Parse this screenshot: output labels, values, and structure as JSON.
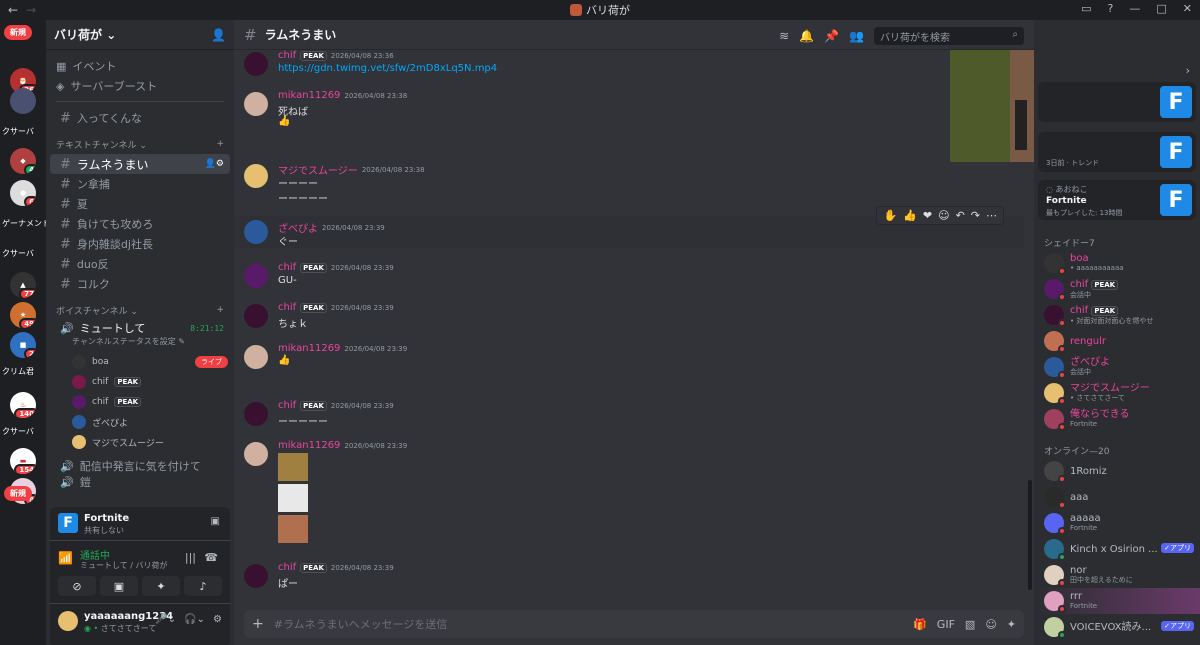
{
  "window": {
    "title": "バリ荷が",
    "nav_back": "←",
    "nav_fwd": "→"
  },
  "rail": {
    "pills": [
      "新規",
      "新規"
    ],
    "labels": [
      "クサーバ",
      "ゲーナメント",
      "クサーバ",
      "クサーバ",
      "クリム君"
    ],
    "badges": [
      "26",
      "4",
      "6",
      "3",
      "77",
      "49",
      "2",
      "140",
      "154",
      "8"
    ]
  },
  "sidebar": {
    "guild_name": "バリ荷が",
    "nav": [
      {
        "label": "イベント",
        "icon": "calendar-icon"
      },
      {
        "label": "サーバーブースト",
        "icon": "boost-icon"
      }
    ],
    "top_channel": "入ってくんな",
    "text_category": "テキストチャンネル",
    "text_channels": [
      "ラムネうまい",
      "ン拿捕",
      "夏",
      "負けても攻めろ",
      "身内雑談dj社長",
      "duo反",
      "コルク"
    ],
    "voice_category": "ボイスチャンネル",
    "voice_channel": {
      "name": "ミュートして",
      "timer": "8:21:12",
      "status": "チャンネルステータスを設定"
    },
    "voice_users": [
      {
        "name": "boa",
        "live": "ライブ"
      },
      {
        "name": "chif",
        "tag": "PEAK"
      },
      {
        "name": "chif",
        "tag": "PEAK"
      },
      {
        "name": "ざべぴよ"
      },
      {
        "name": "マジでスムージー"
      }
    ],
    "voice_channel2": "配信中発言に気を付けて",
    "voice_channel3": "鎧",
    "activity": {
      "game": "Fortnite",
      "sub": "共有しない"
    },
    "call": {
      "status": "通話中",
      "location": "ミュートして / バリ荷が"
    },
    "user": {
      "name": "yaaaaaang1234",
      "status": "さてさてさーて"
    }
  },
  "main": {
    "channel": "ラムネうまい",
    "search_placeholder": "バリ荷がを検索",
    "composer_placeholder": "#ラムネうまいへメッセージを送信",
    "messages": [
      {
        "user": "chif",
        "tag": "PEAK",
        "time": "2026/04/08 23:36",
        "text": "https://gdn.twimg.vet/sfw/2mD8xLq5N.mp4",
        "color": "#eb459f"
      },
      {
        "user": "mikan11269",
        "time": "2026/04/08 23:38",
        "text": "死ねば",
        "emoji": "👍",
        "color": "#eb459f"
      },
      {
        "user": "マジでスムージー",
        "time": "2026/04/08 23:38",
        "text": "ーーーー",
        "text2": "ーーーーー",
        "color": "#eb459f"
      },
      {
        "user": "ざべぴよ",
        "time": "2026/04/08 23:39",
        "text": "ぐー",
        "color": "#eb459f"
      },
      {
        "user": "chif",
        "tag": "PEAK",
        "time": "2026/04/08 23:39",
        "text": "GU-",
        "color": "#eb459f"
      },
      {
        "user": "chif",
        "tag": "PEAK",
        "time": "2026/04/08 23:39",
        "text": "ちょｋ",
        "color": "#eb459f"
      },
      {
        "user": "mikan11269",
        "time": "2026/04/08 23:39",
        "emoji": "👍",
        "color": "#eb459f"
      },
      {
        "user": "chif",
        "tag": "PEAK",
        "time": "2026/04/08 23:39",
        "text": "ーーーーー",
        "color": "#eb459f"
      },
      {
        "user": "mikan11269",
        "time": "2026/04/08 23:39",
        "color": "#eb459f"
      },
      {
        "user": "chif",
        "tag": "PEAK",
        "time": "2026/04/08 23:39",
        "text": "ぱー",
        "color": "#eb459f"
      }
    ]
  },
  "members": {
    "activity_cards": [
      {
        "sub": "3日前 · トレンド"
      },
      {
        "user": "あおねこ",
        "game": "Fortnite",
        "sub": "最もプレイした: 13時間"
      }
    ],
    "group1": "シェイドー7",
    "group1_members": [
      {
        "name": "boa",
        "status": "• aaaaaaaaaaa",
        "color": "#eb459f"
      },
      {
        "name": "chif",
        "tag": "PEAK",
        "status": "会話中",
        "color": "#eb459f"
      },
      {
        "name": "chif",
        "tag": "PEAK",
        "status": "• 対面対面対面心を燃やせ",
        "color": "#eb459f"
      },
      {
        "name": "rengulr",
        "status": "",
        "color": "#eb459f"
      },
      {
        "name": "ざべぴよ",
        "status": "会話中",
        "color": "#eb459f"
      },
      {
        "name": "マジでスムージー",
        "status": "• さてさてさーて",
        "color": "#eb459f"
      },
      {
        "name": "俺ならできる",
        "status": "Fortnite",
        "color": "#eb459f"
      }
    ],
    "group2": "オンライン—20",
    "group2_members": [
      {
        "name": "1Romiz",
        "status": ""
      },
      {
        "name": "aaa",
        "status": ""
      },
      {
        "name": "aaaaa",
        "status": "Fortnite"
      },
      {
        "name": "Kinch x Osirion ...",
        "status": "",
        "app": "✓アプリ"
      },
      {
        "name": "nor",
        "status": "田中を超えるために"
      },
      {
        "name": "rrr",
        "status": "Fortnite"
      },
      {
        "name": "VOICEVOX読み...",
        "status": "",
        "app": "✓アプリ"
      }
    ]
  }
}
